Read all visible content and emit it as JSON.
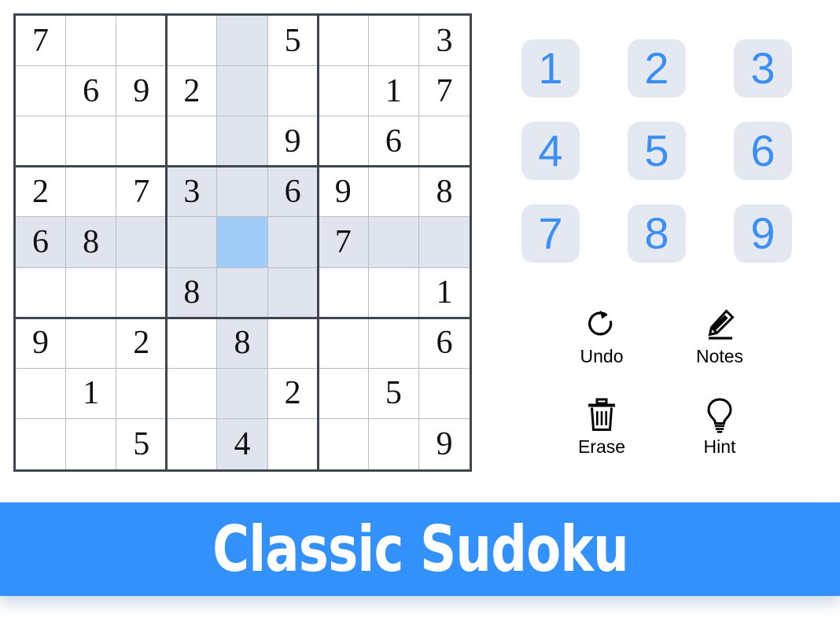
{
  "app": {
    "banner_title": "Classic Sudoku",
    "accent_blue": "#3b8ef4",
    "banner_blue": "#3391fb",
    "pad_button_bg": "#e4e9f1",
    "highlight_bg": "#dfe4ee",
    "selected_bg": "#9fcdf7",
    "grid_line": "#b9bec6",
    "grid_box_line": "#3f464f"
  },
  "board": {
    "rows": 9,
    "cols": 9,
    "selected_cell": {
      "row": 5,
      "col": 5
    },
    "grid": [
      [
        "7",
        "",
        "",
        "",
        "",
        "5",
        "",
        "",
        "3"
      ],
      [
        "",
        "6",
        "9",
        "2",
        "",
        "",
        "",
        "1",
        "7"
      ],
      [
        "",
        "",
        "",
        "",
        "",
        "9",
        "",
        "6",
        ""
      ],
      [
        "2",
        "",
        "7",
        "3",
        "",
        "6",
        "9",
        "",
        "8"
      ],
      [
        "6",
        "8",
        "",
        "",
        "",
        "",
        "7",
        "",
        ""
      ],
      [
        "",
        "",
        "",
        "8",
        "",
        "",
        "",
        "",
        "1"
      ],
      [
        "9",
        "",
        "2",
        "",
        "8",
        "",
        "",
        "",
        "6"
      ],
      [
        "",
        "1",
        "",
        "",
        "",
        "2",
        "",
        "5",
        ""
      ],
      [
        "",
        "",
        "5",
        "",
        "4",
        "",
        "",
        "",
        "9"
      ]
    ]
  },
  "numpad": {
    "buttons": [
      {
        "label": "1",
        "value": 1
      },
      {
        "label": "2",
        "value": 2
      },
      {
        "label": "3",
        "value": 3
      },
      {
        "label": "4",
        "value": 4
      },
      {
        "label": "5",
        "value": 5
      },
      {
        "label": "6",
        "value": 6
      },
      {
        "label": "7",
        "value": 7
      },
      {
        "label": "8",
        "value": 8
      },
      {
        "label": "9",
        "value": 9
      }
    ]
  },
  "tools": [
    {
      "label": "Undo",
      "icon": "undo-circular-arrow-icon"
    },
    {
      "label": "Notes",
      "icon": "pencil-icon"
    },
    {
      "label": "Erase",
      "icon": "trash-can-icon"
    },
    {
      "label": "Hint",
      "icon": "lightbulb-icon"
    }
  ]
}
